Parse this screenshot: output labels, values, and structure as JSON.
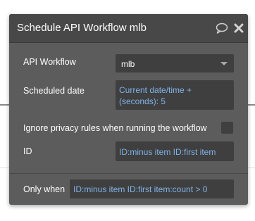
{
  "panel": {
    "title": "Schedule API Workflow mlb",
    "icons": {
      "comment": "comment-icon",
      "close": "close-icon"
    }
  },
  "fields": {
    "api_workflow": {
      "label": "API Workflow",
      "value": "mlb"
    },
    "scheduled_date": {
      "label": "Scheduled date",
      "value": "Current date/time +\n(seconds): 5"
    },
    "ignore_privacy": {
      "label": "Ignore privacy rules when running the workflow",
      "checked": false
    },
    "id": {
      "label": "ID",
      "value": "ID:minus item ID:first item"
    },
    "only_when": {
      "label": "Only when",
      "value": "ID:minus item ID:first item:count > 0"
    }
  },
  "colors": {
    "panel_bg": "#5c5c5c",
    "header_bg": "#484848",
    "field_bg": "#3f3f3f",
    "expression_text": "#7fb3e8",
    "label_text": "#ffffff"
  }
}
